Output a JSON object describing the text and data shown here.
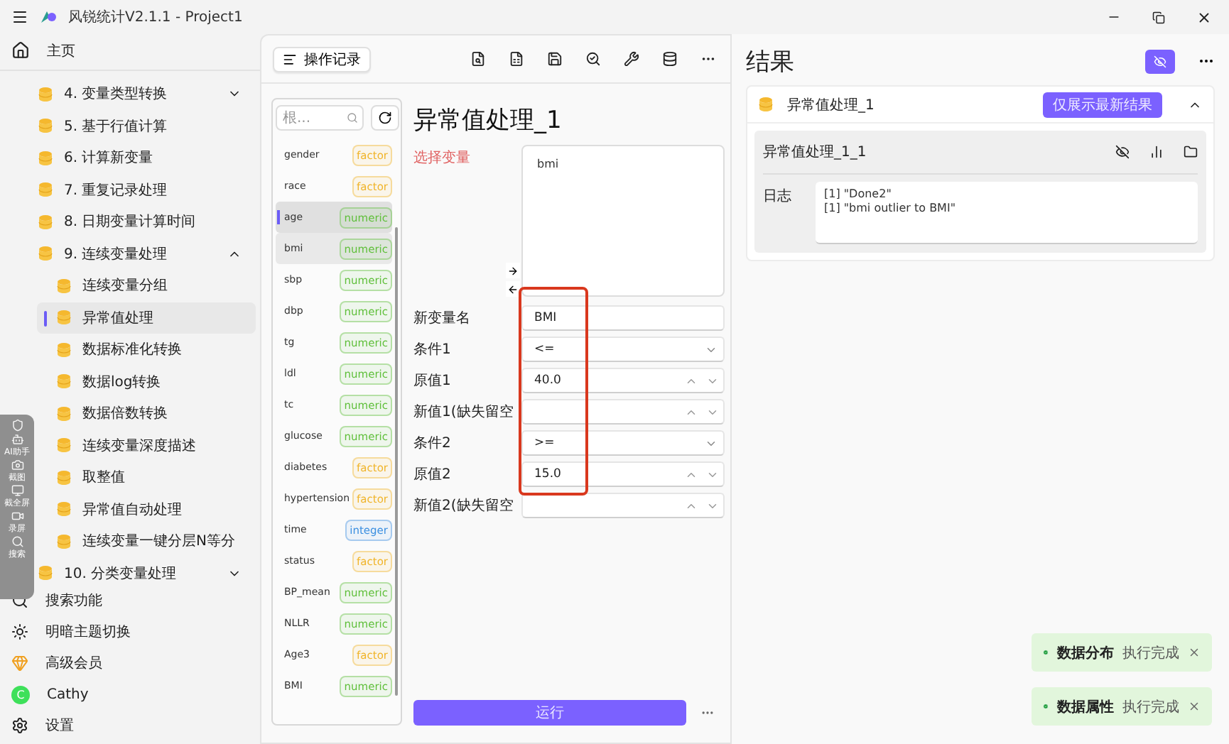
{
  "window": {
    "title": "风锐统计V2.1.1 - Project1"
  },
  "sidebar": {
    "home": "主页",
    "items": [
      {
        "label": "4. 变量类型转换",
        "kind": "group",
        "expanded": false
      },
      {
        "label": "5. 基于行值计算",
        "kind": "item"
      },
      {
        "label": "6. 计算新变量",
        "kind": "item"
      },
      {
        "label": "7. 重复记录处理",
        "kind": "item"
      },
      {
        "label": "8. 日期变量计算时间",
        "kind": "item"
      },
      {
        "label": "9. 连续变量处理",
        "kind": "group",
        "expanded": true,
        "children": [
          {
            "label": "连续变量分组",
            "selected": false
          },
          {
            "label": "异常值处理",
            "selected": true
          },
          {
            "label": "数据标准化转换",
            "selected": false
          },
          {
            "label": "数据log转换",
            "selected": false
          },
          {
            "label": "数据倍数转换",
            "selected": false
          },
          {
            "label": "连续变量深度描述",
            "selected": false
          },
          {
            "label": "取整值",
            "selected": false
          },
          {
            "label": "异常值自动处理",
            "selected": false
          },
          {
            "label": "连续变量一键分层N等分",
            "selected": false
          }
        ]
      },
      {
        "label": "10. 分类变量处理",
        "kind": "group",
        "expanded": false
      }
    ],
    "footer": [
      {
        "label": "搜索功能",
        "kind": "search"
      },
      {
        "label": "明暗主题切换",
        "kind": "theme"
      },
      {
        "label": "高级会员",
        "kind": "vip"
      },
      {
        "label": "Cathy",
        "kind": "avatar",
        "initial": "C"
      },
      {
        "label": "设置",
        "kind": "settings"
      }
    ]
  },
  "float_tools": [
    {
      "label": "AI助手",
      "kind": "ai"
    },
    {
      "label": "截图",
      "kind": "camera"
    },
    {
      "label": "截全屏",
      "kind": "screen"
    },
    {
      "label": "录屏",
      "kind": "video"
    },
    {
      "label": "搜索",
      "kind": "search"
    }
  ],
  "toolbar": {
    "history_button": "操作记录"
  },
  "variables": {
    "search_placeholder": "根...",
    "items": [
      {
        "name": "gender",
        "type": "factor",
        "color": "#f0b429",
        "selected": false,
        "hovered": false
      },
      {
        "name": "race",
        "type": "factor",
        "color": "#f0b429",
        "selected": false,
        "hovered": false
      },
      {
        "name": "age",
        "type": "numeric",
        "color": "#5fbf3a",
        "selected": true,
        "hovered": false
      },
      {
        "name": "bmi",
        "type": "numeric",
        "color": "#5fbf3a",
        "selected": false,
        "hovered": true
      },
      {
        "name": "sbp",
        "type": "numeric",
        "color": "#5fbf3a",
        "selected": false,
        "hovered": false
      },
      {
        "name": "dbp",
        "type": "numeric",
        "color": "#5fbf3a",
        "selected": false,
        "hovered": false
      },
      {
        "name": "tg",
        "type": "numeric",
        "color": "#5fbf3a",
        "selected": false,
        "hovered": false
      },
      {
        "name": "ldl",
        "type": "numeric",
        "color": "#5fbf3a",
        "selected": false,
        "hovered": false
      },
      {
        "name": "tc",
        "type": "numeric",
        "color": "#5fbf3a",
        "selected": false,
        "hovered": false
      },
      {
        "name": "glucose",
        "type": "numeric",
        "color": "#5fbf3a",
        "selected": false,
        "hovered": false
      },
      {
        "name": "diabetes",
        "type": "factor",
        "color": "#f0b429",
        "selected": false,
        "hovered": false
      },
      {
        "name": "hypertension",
        "type": "factor",
        "color": "#f0b429",
        "selected": false,
        "hovered": false
      },
      {
        "name": "time",
        "type": "integer",
        "color": "#3b8fe0",
        "selected": false,
        "hovered": false
      },
      {
        "name": "status",
        "type": "factor",
        "color": "#f0b429",
        "selected": false,
        "hovered": false
      },
      {
        "name": "BP_mean",
        "type": "numeric",
        "color": "#5fbf3a",
        "selected": false,
        "hovered": false
      },
      {
        "name": "NLLR",
        "type": "numeric",
        "color": "#5fbf3a",
        "selected": false,
        "hovered": false
      },
      {
        "name": "Age3",
        "type": "factor",
        "color": "#f0b429",
        "selected": false,
        "hovered": false
      },
      {
        "name": "BMI",
        "type": "numeric",
        "color": "#5fbf3a",
        "selected": false,
        "hovered": false
      }
    ]
  },
  "form": {
    "title": "异常值处理_1",
    "select_label": "选择变量",
    "selected_variables": [
      "bmi"
    ],
    "fields": [
      {
        "label": "新变量名",
        "kind": "text",
        "value": "BMI"
      },
      {
        "label": "条件1",
        "kind": "select",
        "value": "<="
      },
      {
        "label": "原值1",
        "kind": "number",
        "value": "40.0"
      },
      {
        "label": "新值1(缺失留空",
        "kind": "number"
      },
      {
        "label": "条件2",
        "kind": "select",
        "value": ">="
      },
      {
        "label": "原值2",
        "kind": "number",
        "value": "15.0"
      },
      {
        "label": "新值2(缺失留空",
        "kind": "number"
      }
    ],
    "run_button": "运行"
  },
  "results": {
    "title": "结果",
    "card": {
      "title": "异常值处理_1",
      "latest_button": "仅展示最新结果",
      "expanded": true,
      "result": {
        "title": "异常值处理_1_1",
        "log_label": "日志",
        "log_lines": [
          "[1] \"Done2\"",
          "[1] \"bmi outlier to BMI\""
        ]
      }
    }
  },
  "toasts": [
    {
      "title": "数据分布",
      "message": "执行完成"
    },
    {
      "title": "数据属性",
      "message": "执行完成"
    }
  ]
}
